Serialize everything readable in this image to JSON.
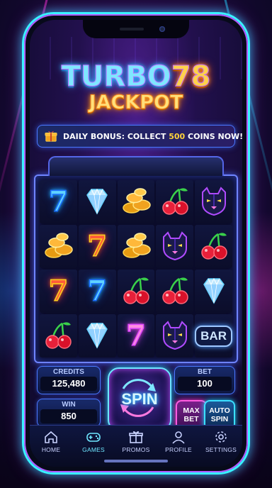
{
  "logo": {
    "line1_a": "TURBO",
    "line1_b": "78",
    "line2": "JACKPOT"
  },
  "bonus": {
    "text_before": "DAILY BONUS: COLLECT ",
    "highlight": "500",
    "text_after": " COINS NOW!",
    "icon": "gift-icon",
    "arrow": "›"
  },
  "reels": {
    "rows": [
      [
        "seven-blue",
        "diamond",
        "coins",
        "cherry",
        "panther"
      ],
      [
        "coins",
        "seven-red",
        "coins",
        "panther",
        "cherry"
      ],
      [
        "seven-red",
        "seven-blue",
        "cherry",
        "cherry",
        "diamond"
      ],
      [
        "cherry",
        "diamond",
        "seven-pink",
        "panther",
        "bar"
      ]
    ],
    "seven_glyph": "7",
    "bar_label": "BAR"
  },
  "panel": {
    "credits_label": "CREDITS",
    "credits_value": "125,480",
    "win_label": "WIN",
    "win_value": "850",
    "bet_label": "BET",
    "bet_value": "100",
    "spin_label": "SPIN",
    "max_bet_line1": "MAX",
    "max_bet_line2": "BET",
    "auto_spin_line1": "AUTO",
    "auto_spin_line2": "SPIN"
  },
  "nav": {
    "items": [
      {
        "label": "HOME",
        "icon": "home-icon",
        "active": false
      },
      {
        "label": "GAMES",
        "icon": "gamepad-icon",
        "active": true
      },
      {
        "label": "PROMOS",
        "icon": "gift-icon",
        "active": false
      },
      {
        "label": "PROFILE",
        "icon": "user-icon",
        "active": false
      },
      {
        "label": "SETTINGS",
        "icon": "gear-icon",
        "active": false
      }
    ]
  },
  "colors": {
    "accent_cyan": "#39f2ff",
    "accent_magenta": "#ff3bd0",
    "gold": "#ffd24a"
  }
}
